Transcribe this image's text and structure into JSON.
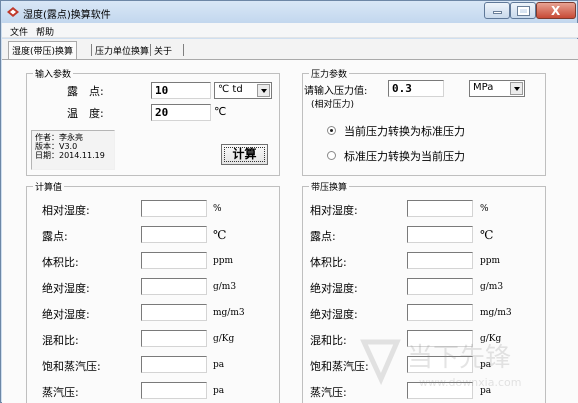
{
  "window": {
    "title": "湿度(露点)换算软件",
    "controls": {
      "minimize": "minimize",
      "maximize": "maximize",
      "close": "X"
    }
  },
  "menu": [
    "文件",
    "帮助"
  ],
  "tabs": [
    "湿度(带压)换算",
    "压力单位换算",
    "关于"
  ],
  "input_group": {
    "title": "输入参数",
    "dew_label": "露　点:",
    "dew_value": "10",
    "dew_unit": "℃ td",
    "temp_label": "温　度:",
    "temp_value": "20",
    "temp_unit": "℃",
    "author_lines": [
      "作者：李永亮",
      "版本：V3.0",
      "日期：2014.11.19"
    ],
    "calc_button": "计算"
  },
  "pressure_group": {
    "title": "压力参数",
    "label": "请输入压力值:",
    "sublabel": "(相对压力)",
    "value": "0.3",
    "unit": "MPa",
    "radio_options": [
      {
        "label": "当前压力转换为标准压力",
        "selected": true
      },
      {
        "label": "标准压力转换为当前压力",
        "selected": false
      }
    ]
  },
  "calc_group": {
    "title": "计算值",
    "rows": [
      {
        "label": "相对湿度:",
        "unit": "%"
      },
      {
        "label": "露点:",
        "unit": "℃"
      },
      {
        "label": "体积比:",
        "unit": "ppm"
      },
      {
        "label": "绝对湿度:",
        "unit": "g/m3"
      },
      {
        "label": "绝对湿度:",
        "unit": "mg/m3"
      },
      {
        "label": "混和比:",
        "unit": "g/Kg"
      },
      {
        "label": "饱和蒸汽压:",
        "unit": "pa"
      },
      {
        "label": "蒸汽压:",
        "unit": "pa"
      }
    ]
  },
  "pressure_calc_group": {
    "title": "带压换算",
    "rows": [
      {
        "label": "相对湿度:",
        "unit": "%"
      },
      {
        "label": "露点:",
        "unit": "℃"
      },
      {
        "label": "体积比:",
        "unit": "ppm"
      },
      {
        "label": "绝对湿度:",
        "unit": "g/m3"
      },
      {
        "label": "绝对湿度:",
        "unit": "mg/m3"
      },
      {
        "label": "混和比:",
        "unit": "g/Kg"
      },
      {
        "label": "饱和蒸汽压:",
        "unit": "pa"
      },
      {
        "label": "蒸汽压:",
        "unit": "pa"
      }
    ]
  },
  "watermark": {
    "text": "当下先锋",
    "url": "www.downxia.com"
  }
}
